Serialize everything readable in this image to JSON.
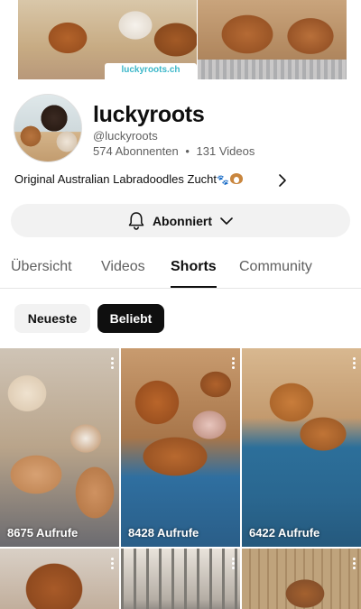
{
  "banner": {
    "logo_text": "luckyroots.ch"
  },
  "channel": {
    "name": "luckyroots",
    "handle": "@luckyroots",
    "subscribers": "574 Abonnenten",
    "separator": "•",
    "videos": "131 Videos",
    "description": "Original Australian Labradoodles Zucht"
  },
  "subscribe": {
    "label": "Abonniert"
  },
  "tabs": [
    {
      "label": "Übersicht",
      "active": false
    },
    {
      "label": "Videos",
      "active": false
    },
    {
      "label": "Shorts",
      "active": true
    },
    {
      "label": "Community",
      "active": false
    }
  ],
  "chips": [
    {
      "label": "Neueste",
      "selected": false
    },
    {
      "label": "Beliebt",
      "selected": true
    }
  ],
  "shorts": [
    {
      "views": "8675 Aufrufe"
    },
    {
      "views": "8428 Aufrufe"
    },
    {
      "views": "6422 Aufrufe"
    },
    {
      "views": ""
    },
    {
      "views": ""
    },
    {
      "views": ""
    }
  ],
  "icons": {
    "bell": "bell-icon",
    "chevron_down": "chevron-down-icon",
    "chevron_right": "chevron-right-icon",
    "more": "more-vertical-icon"
  },
  "colors": {
    "text": "#0f0f0f",
    "secondary_text": "#606060",
    "chip_selected_bg": "#0f0f0f",
    "chip_bg": "#f2f2f2"
  }
}
